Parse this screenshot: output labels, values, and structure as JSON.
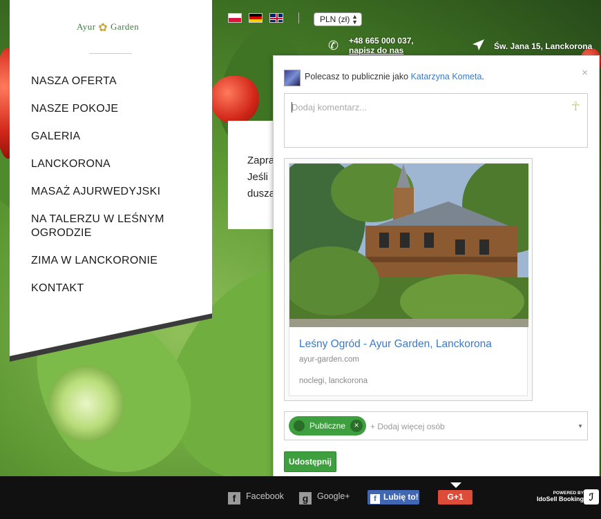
{
  "site": {
    "logo_text": "AYUR GARDEN",
    "logo_left": "Ayur",
    "logo_right": "Garden"
  },
  "topbar": {
    "languages": [
      "pl",
      "de",
      "en"
    ],
    "currency": "PLN (zł)",
    "phone": "+48 665 000 037,",
    "phone_sub": "napisz do nas",
    "address": "Św. Jana 15, Lanckorona"
  },
  "nav": {
    "items": [
      {
        "label": "NASZA OFERTA"
      },
      {
        "label": "NASZE POKOJE"
      },
      {
        "label": "GALERIA"
      },
      {
        "label": "LANCKORONA"
      },
      {
        "label": "MASAŻ AJURWEDYJSKI"
      },
      {
        "label": "NA TALERZU W LEŚNYM OGRODZIE"
      },
      {
        "label": "ZIMA W LANCKORONIE"
      },
      {
        "label": "KONTAKT"
      }
    ]
  },
  "content": {
    "lines": [
      "Zapra",
      "Jeśli",
      "dusza"
    ]
  },
  "share_popup": {
    "share_as_prefix": "Polecasz to publicznie jako",
    "user_name": "Katarzyna Kometa",
    "share_as_suffix": ".",
    "close": "×",
    "comment_placeholder": "Dodaj komentarz...",
    "preview": {
      "title": "Leśny Ogród - Ayur Garden, Lanckorona",
      "domain": "ayur-garden.com",
      "tags": "noclegi, lanckorona"
    },
    "audience_chip": "Publiczne",
    "add_people_placeholder": "+ Dodaj więcej osób",
    "share_button": "Udostępnij"
  },
  "footer": {
    "facebook": "Facebook",
    "googleplus": "Google+",
    "fb_like": "Lubię to!",
    "gplus_button": "G+1",
    "powered_by": "POWERED BY",
    "powered_brand": "IdoSell Booking"
  },
  "colors": {
    "accent_blue": "#3a79c9",
    "share_green": "#3e9f3e",
    "gplus_red": "#dd4b39",
    "fb_blue": "#4267b2"
  }
}
